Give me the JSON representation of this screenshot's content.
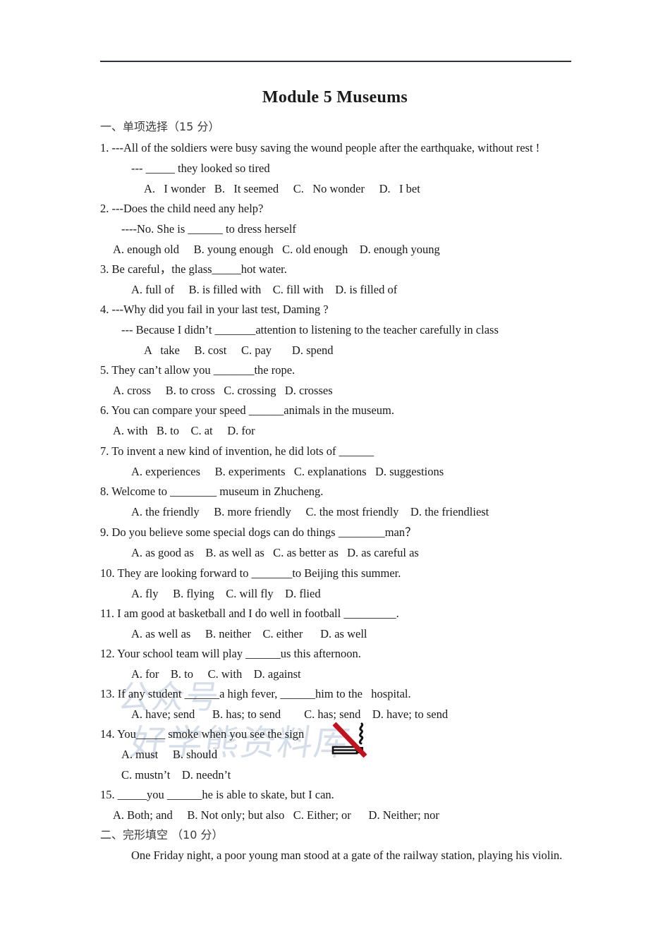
{
  "document": {
    "title": "Module 5 Museums",
    "watermark": {
      "line1": "公众号",
      "line2": "好学熊资料库"
    },
    "sections": [
      {
        "heading": "一、单项选择（15 分）"
      },
      {
        "heading": "二、完形填空 （10 分）",
        "body": "One Friday night, a poor young man stood at a gate of the railway station, playing his violin."
      }
    ],
    "questions": [
      {
        "number": "1.",
        "lines": [
          "1. ---All of the soldiers were busy saving the wound people after the earthquake, without rest !",
          "--- _____ they looked so tired",
          "A.   I wonder   B.   It seemed     C.   No wonder     D.   I bet"
        ]
      },
      {
        "number": "2.",
        "lines": [
          "2. ---Does the child need any help?",
          "----No. She is ______ to dress herself",
          "A. enough old     B. young enough   C. old enough    D. enough young"
        ]
      },
      {
        "number": "3.",
        "lines": [
          "3. Be careful，the glass_____hot water.",
          "A. full of     B. is filled with    C. fill with    D. is filled of"
        ]
      },
      {
        "number": "4.",
        "lines": [
          "4. ---Why did you fail in your last test, Daming ?",
          "--- Because I didn’t _______attention to listening to the teacher carefully in class",
          "A   take     B. cost     C. pay       D. spend"
        ]
      },
      {
        "number": "5.",
        "lines": [
          "5. They can’t allow you _______the rope.",
          "A. cross     B. to cross   C. crossing   D. crosses"
        ]
      },
      {
        "number": "6.",
        "lines": [
          "6. You can compare your speed ______animals in the museum.",
          "A. with   B. to    C. at     D. for"
        ]
      },
      {
        "number": "7.",
        "lines": [
          "7. To invent a new kind of invention, he did lots of ______",
          "A. experiences     B. experiments   C. explanations   D. suggestions"
        ]
      },
      {
        "number": "8.",
        "lines": [
          "8. Welcome to ________ museum in Zhucheng.",
          "A. the friendly     B. more friendly     C. the most friendly    D. the friendliest"
        ]
      },
      {
        "number": "9.",
        "lines": [
          "9. Do you believe some special dogs can do things ________man？",
          "A. as good as    B. as well as   C. as better as   D. as careful as"
        ]
      },
      {
        "number": "10.",
        "lines": [
          "10. They are looking forward to _______to Beijing this summer.",
          "A. fly     B. flying    C. will fly    D. flied"
        ]
      },
      {
        "number": "11.",
        "lines": [
          "11. I am good at basketball and I do well in football _________.",
          "A. as well as     B. neither    C. either      D. as well"
        ]
      },
      {
        "number": "12.",
        "lines": [
          "12. Your school team will play ______us this afternoon.",
          "A. for    B. to     C. with    D. against"
        ]
      },
      {
        "number": "13.",
        "lines": [
          "13. If any student ______a high fever, ______him to the   hospital.",
          "A. have; send      B. has; to send        C. has; send    D. have; to send"
        ]
      },
      {
        "number": "14.",
        "lines": [
          "14. You_____ smoke when you see the sign",
          "A. must     B. should",
          "C. mustn’t    D. needn’t"
        ],
        "image": "no-smoking-sign"
      },
      {
        "number": "15.",
        "lines": [
          "15. _____you ______he is able to skate, but I can.",
          "A. Both; and     B. Not only; but also   C. Either; or      D. Neither; nor"
        ]
      }
    ],
    "colors": {
      "rule": "#2f3336",
      "text": "#1a1a1a",
      "watermark": "#c9d4e2",
      "sign_slash": "#c1121f"
    }
  }
}
